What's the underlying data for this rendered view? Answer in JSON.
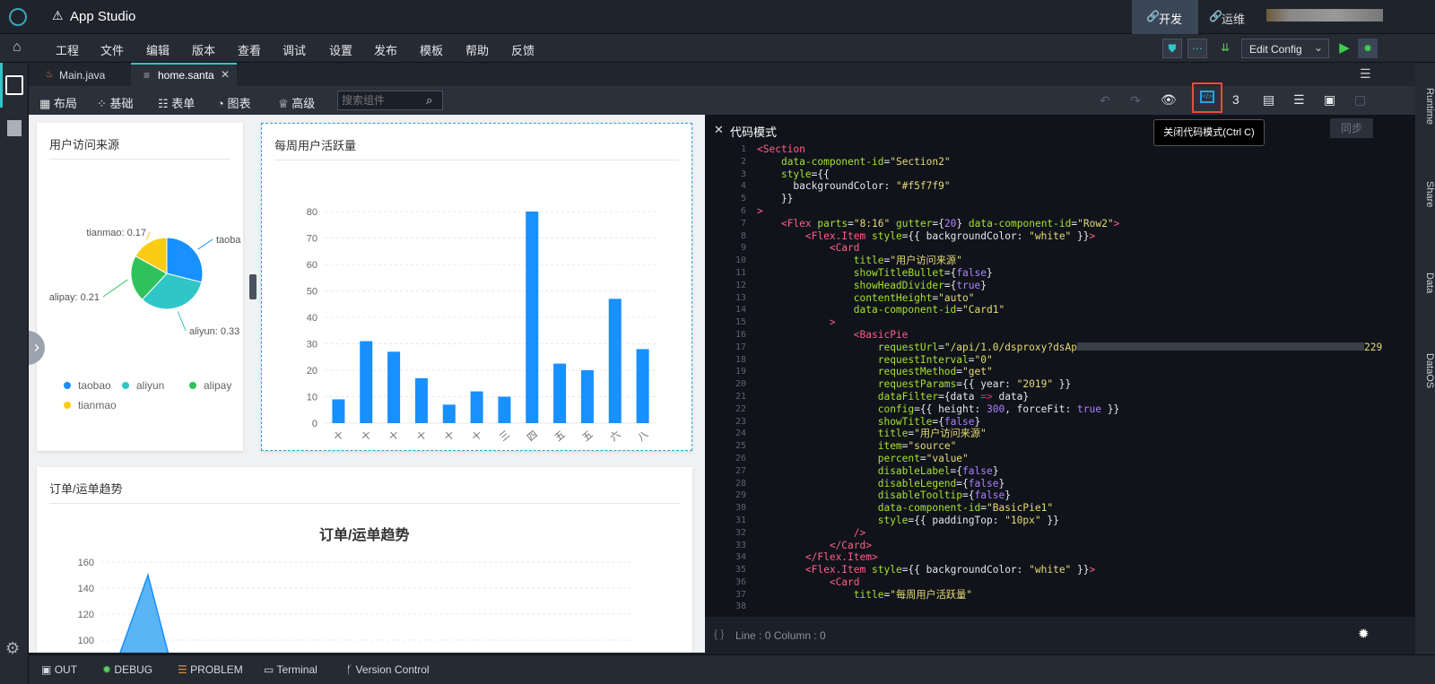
{
  "app": {
    "title": "App Studio"
  },
  "topnav": {
    "dev": "开发",
    "ops": "运维"
  },
  "menu": [
    "工程",
    "文件",
    "编辑",
    "版本",
    "查看",
    "调试",
    "设置",
    "发布",
    "模板",
    "帮助",
    "反馈"
  ],
  "menu_right": {
    "edit_config": "Edit Config"
  },
  "tabs": [
    {
      "label": "Main.java",
      "active": false
    },
    {
      "label": "home.santa",
      "active": true
    }
  ],
  "toolbar": {
    "layout": "布局",
    "basic": "基础",
    "form": "表单",
    "chart": "图表",
    "advanced": "高级",
    "search_placeholder": "搜索组件",
    "tooltip": "关闭代码模式(Ctrl C)"
  },
  "right_tabs": [
    "Runtime",
    "Share",
    "Data",
    "DataOS"
  ],
  "code_panel": {
    "title": "代码模式",
    "sync": "同步",
    "status": "Line : 0 Column : 0"
  },
  "cards": {
    "pie_title": "用户访问来源",
    "bar_title": "每周用户活跃量",
    "trend_title": "订单/运单趋势",
    "trend_chart_title": "订单/运单趋势"
  },
  "chart_data": [
    {
      "type": "pie",
      "categories": [
        "taobao",
        "aliyun",
        "alipay",
        "tianmao"
      ],
      "values": [
        0.29,
        0.33,
        0.21,
        0.17
      ],
      "slice_labels": [
        "taoba",
        "aliyun: 0.33",
        "alipay: 0.21",
        "tianmao: 0.17"
      ],
      "colors": [
        "#1890ff",
        "#2fc6c8",
        "#2fc25b",
        "#facc14"
      ],
      "legend": "bottom"
    },
    {
      "type": "bar",
      "categories": [
        "十",
        "十",
        "十",
        "十",
        "十",
        "十",
        "三",
        "四",
        "五",
        "五",
        "六",
        "八"
      ],
      "values": [
        9,
        31,
        27,
        17,
        7,
        12,
        10,
        80,
        22.5,
        20,
        47,
        28
      ],
      "ylim": [
        0,
        80
      ],
      "yticks": [
        0,
        10,
        20,
        30,
        40,
        50,
        60,
        70,
        80
      ],
      "color": "#1890ff",
      "grid": true
    },
    {
      "type": "area",
      "title": "订单/运单趋势",
      "yticks": [
        100,
        120,
        140,
        160
      ],
      "peak": 150,
      "color": "#5ab4f5",
      "grid": true
    }
  ],
  "status": {
    "out": "OUT",
    "debug": "DEBUG",
    "problem": "PROBLEM",
    "terminal": "Terminal",
    "vc": "Version Control"
  }
}
